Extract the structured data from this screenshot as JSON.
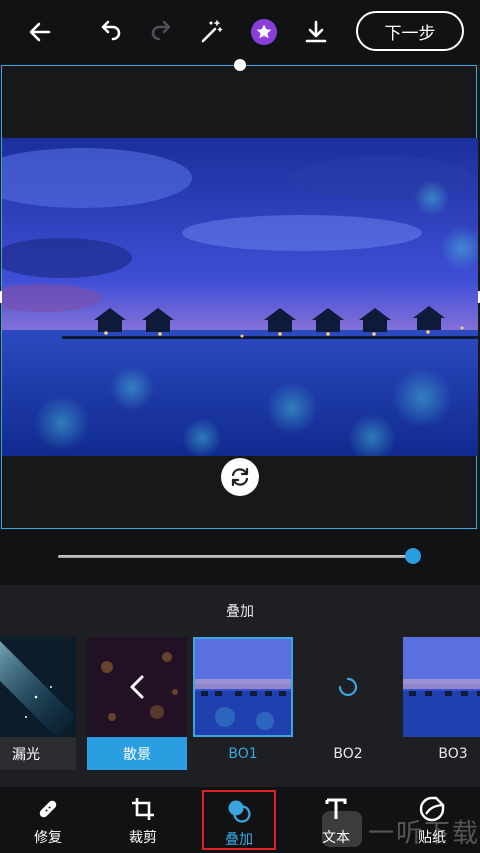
{
  "toolbar": {
    "back_icon": "back-arrow-icon",
    "undo_icon": "undo-icon",
    "redo_icon": "redo-icon",
    "magic_icon": "magic-wand-icon",
    "premium_icon": "star-badge-icon",
    "download_icon": "download-icon",
    "next_label": "下一步"
  },
  "slider": {
    "value": 0.98
  },
  "panel": {
    "title": "叠加",
    "items": [
      {
        "label": "漏光"
      },
      {
        "label": "散景"
      },
      {
        "label": "BO1"
      },
      {
        "label": "BO2"
      },
      {
        "label": "BO3"
      }
    ]
  },
  "nav": {
    "items": [
      {
        "label": "修复",
        "icon": "bandage-icon"
      },
      {
        "label": "裁剪",
        "icon": "crop-icon"
      },
      {
        "label": "叠加",
        "icon": "overlay-icon"
      },
      {
        "label": "文本",
        "icon": "text-icon"
      },
      {
        "label": "贴纸",
        "icon": "sticker-icon"
      }
    ]
  },
  "watermark": "一听下载",
  "colors": {
    "accent": "#2a9ee0",
    "highlight_border": "#e02424",
    "selected_tile": "#3aa6e0"
  }
}
